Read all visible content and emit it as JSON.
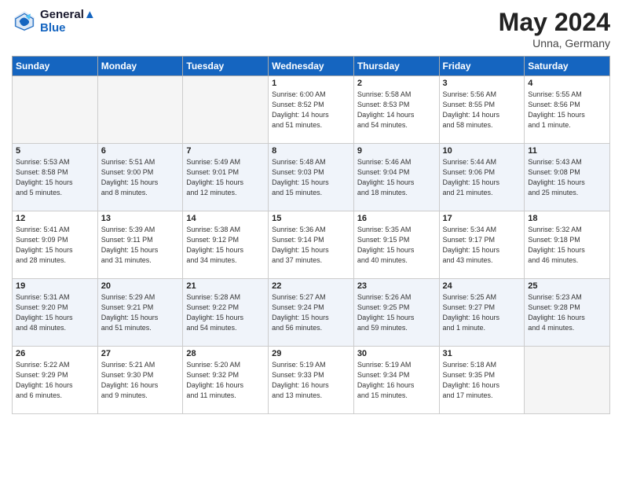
{
  "header": {
    "logo_line1": "General",
    "logo_line2": "Blue",
    "month": "May 2024",
    "location": "Unna, Germany"
  },
  "weekdays": [
    "Sunday",
    "Monday",
    "Tuesday",
    "Wednesday",
    "Thursday",
    "Friday",
    "Saturday"
  ],
  "weeks": [
    [
      {
        "day": "",
        "info": ""
      },
      {
        "day": "",
        "info": ""
      },
      {
        "day": "",
        "info": ""
      },
      {
        "day": "1",
        "info": "Sunrise: 6:00 AM\nSunset: 8:52 PM\nDaylight: 14 hours\nand 51 minutes."
      },
      {
        "day": "2",
        "info": "Sunrise: 5:58 AM\nSunset: 8:53 PM\nDaylight: 14 hours\nand 54 minutes."
      },
      {
        "day": "3",
        "info": "Sunrise: 5:56 AM\nSunset: 8:55 PM\nDaylight: 14 hours\nand 58 minutes."
      },
      {
        "day": "4",
        "info": "Sunrise: 5:55 AM\nSunset: 8:56 PM\nDaylight: 15 hours\nand 1 minute."
      }
    ],
    [
      {
        "day": "5",
        "info": "Sunrise: 5:53 AM\nSunset: 8:58 PM\nDaylight: 15 hours\nand 5 minutes."
      },
      {
        "day": "6",
        "info": "Sunrise: 5:51 AM\nSunset: 9:00 PM\nDaylight: 15 hours\nand 8 minutes."
      },
      {
        "day": "7",
        "info": "Sunrise: 5:49 AM\nSunset: 9:01 PM\nDaylight: 15 hours\nand 12 minutes."
      },
      {
        "day": "8",
        "info": "Sunrise: 5:48 AM\nSunset: 9:03 PM\nDaylight: 15 hours\nand 15 minutes."
      },
      {
        "day": "9",
        "info": "Sunrise: 5:46 AM\nSunset: 9:04 PM\nDaylight: 15 hours\nand 18 minutes."
      },
      {
        "day": "10",
        "info": "Sunrise: 5:44 AM\nSunset: 9:06 PM\nDaylight: 15 hours\nand 21 minutes."
      },
      {
        "day": "11",
        "info": "Sunrise: 5:43 AM\nSunset: 9:08 PM\nDaylight: 15 hours\nand 25 minutes."
      }
    ],
    [
      {
        "day": "12",
        "info": "Sunrise: 5:41 AM\nSunset: 9:09 PM\nDaylight: 15 hours\nand 28 minutes."
      },
      {
        "day": "13",
        "info": "Sunrise: 5:39 AM\nSunset: 9:11 PM\nDaylight: 15 hours\nand 31 minutes."
      },
      {
        "day": "14",
        "info": "Sunrise: 5:38 AM\nSunset: 9:12 PM\nDaylight: 15 hours\nand 34 minutes."
      },
      {
        "day": "15",
        "info": "Sunrise: 5:36 AM\nSunset: 9:14 PM\nDaylight: 15 hours\nand 37 minutes."
      },
      {
        "day": "16",
        "info": "Sunrise: 5:35 AM\nSunset: 9:15 PM\nDaylight: 15 hours\nand 40 minutes."
      },
      {
        "day": "17",
        "info": "Sunrise: 5:34 AM\nSunset: 9:17 PM\nDaylight: 15 hours\nand 43 minutes."
      },
      {
        "day": "18",
        "info": "Sunrise: 5:32 AM\nSunset: 9:18 PM\nDaylight: 15 hours\nand 46 minutes."
      }
    ],
    [
      {
        "day": "19",
        "info": "Sunrise: 5:31 AM\nSunset: 9:20 PM\nDaylight: 15 hours\nand 48 minutes."
      },
      {
        "day": "20",
        "info": "Sunrise: 5:29 AM\nSunset: 9:21 PM\nDaylight: 15 hours\nand 51 minutes."
      },
      {
        "day": "21",
        "info": "Sunrise: 5:28 AM\nSunset: 9:22 PM\nDaylight: 15 hours\nand 54 minutes."
      },
      {
        "day": "22",
        "info": "Sunrise: 5:27 AM\nSunset: 9:24 PM\nDaylight: 15 hours\nand 56 minutes."
      },
      {
        "day": "23",
        "info": "Sunrise: 5:26 AM\nSunset: 9:25 PM\nDaylight: 15 hours\nand 59 minutes."
      },
      {
        "day": "24",
        "info": "Sunrise: 5:25 AM\nSunset: 9:27 PM\nDaylight: 16 hours\nand 1 minute."
      },
      {
        "day": "25",
        "info": "Sunrise: 5:23 AM\nSunset: 9:28 PM\nDaylight: 16 hours\nand 4 minutes."
      }
    ],
    [
      {
        "day": "26",
        "info": "Sunrise: 5:22 AM\nSunset: 9:29 PM\nDaylight: 16 hours\nand 6 minutes."
      },
      {
        "day": "27",
        "info": "Sunrise: 5:21 AM\nSunset: 9:30 PM\nDaylight: 16 hours\nand 9 minutes."
      },
      {
        "day": "28",
        "info": "Sunrise: 5:20 AM\nSunset: 9:32 PM\nDaylight: 16 hours\nand 11 minutes."
      },
      {
        "day": "29",
        "info": "Sunrise: 5:19 AM\nSunset: 9:33 PM\nDaylight: 16 hours\nand 13 minutes."
      },
      {
        "day": "30",
        "info": "Sunrise: 5:19 AM\nSunset: 9:34 PM\nDaylight: 16 hours\nand 15 minutes."
      },
      {
        "day": "31",
        "info": "Sunrise: 5:18 AM\nSunset: 9:35 PM\nDaylight: 16 hours\nand 17 minutes."
      },
      {
        "day": "",
        "info": ""
      }
    ]
  ]
}
